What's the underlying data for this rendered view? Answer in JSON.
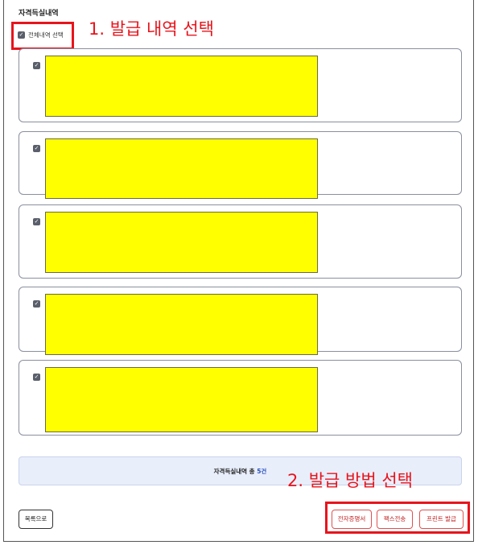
{
  "page": {
    "title": "자격득실내역",
    "select_all_label": "전체내역 선택",
    "select_all_checked": true
  },
  "annotations": {
    "step1": "1. 발급 내역 선택",
    "step2": "2. 발급 방법 선택",
    "color": "#e8141c"
  },
  "records": [
    {
      "checked": true,
      "redacted": true
    },
    {
      "checked": true,
      "redacted": true
    },
    {
      "checked": true,
      "redacted": true
    },
    {
      "checked": true,
      "redacted": true
    },
    {
      "checked": true,
      "redacted": true
    }
  ],
  "summary": {
    "label": "자격득실내역 총",
    "count": "5건"
  },
  "buttons": {
    "back": "목록으로",
    "electronic_cert": "전자증명서",
    "fax": "팩스전송",
    "print": "프린트 발급"
  },
  "colors": {
    "redaction": "#ffff00",
    "summary_bg": "#e9eefb",
    "count_accent": "#2a52be",
    "button_accent": "#e05050"
  }
}
